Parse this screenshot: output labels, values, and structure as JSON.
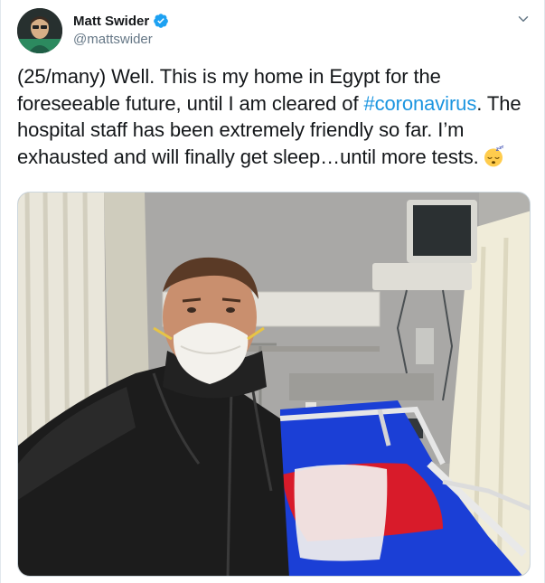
{
  "author": {
    "display_name": "Matt Swider",
    "handle": "@mattswider",
    "verified": true,
    "avatar_icon": "user-avatar"
  },
  "tweet": {
    "text_before": "(25/many) Well. This is my home in Egypt for the foreseeable future, until I am cleared of ",
    "hashtag": "#coronavirus",
    "text_after": ". The hospital staff has been extremely friendly so far. I’m exhausted and will finally get sleep…until more tests.",
    "emoji": "sleeping-face-emoji"
  },
  "menu_icon": "chevron-down-icon",
  "colors": {
    "link": "#1b95e0",
    "verified": "#1da1f2",
    "text": "#14171a",
    "secondary": "#657786"
  },
  "media": {
    "type": "photo",
    "subject": "selfie-in-hospital-room"
  }
}
